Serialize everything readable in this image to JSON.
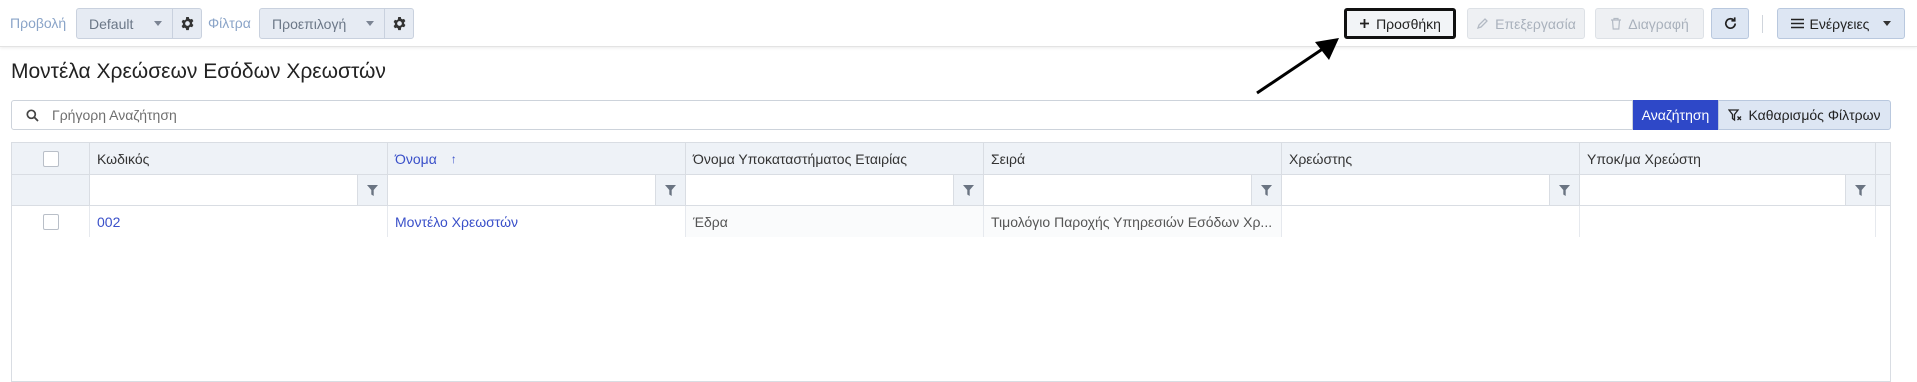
{
  "toolbar": {
    "view_label": "Προβολή",
    "view_value": "Default",
    "filters_label": "Φίλτρα",
    "filters_value": "Προεπιλογή",
    "add_label": "Προσθήκη",
    "edit_label": "Επεξεργασία",
    "delete_label": "Διαγραφή",
    "actions_label": "Ενέργειες"
  },
  "page": {
    "title": "Μοντέλα Χρεώσεων Εσόδων Χρεωστών"
  },
  "search": {
    "placeholder": "Γρήγορη Αναζήτηση",
    "value": "",
    "search_button": "Αναζήτηση",
    "clear_button": "Καθαρισμός Φίλτρων"
  },
  "grid": {
    "columns": [
      "Κωδικός",
      "Όνομα",
      "Όνομα Υποκαταστήματος Εταιρίας",
      "Σειρά",
      "Χρεώστης",
      "Υποκ/μα Χρεώστη"
    ],
    "sort_indicator": "↑",
    "rows": [
      [
        "002",
        "Μοντέλο Χρεωστών",
        "Έδρα",
        "Τιμολόγιο Παροχής Υπηρεσιών Εσόδων Χρ...",
        "",
        ""
      ]
    ]
  },
  "colors": {
    "accent": "#2e48c8",
    "link": "#3a50c9",
    "header_bg": "#eef2f7"
  },
  "icons": [
    "gear-icon",
    "plus-icon",
    "pencil-icon",
    "trash-icon",
    "refresh-icon",
    "hamburger-icon",
    "search-icon",
    "clear-filter-icon",
    "filter-icon",
    "sort-asc-icon"
  ]
}
